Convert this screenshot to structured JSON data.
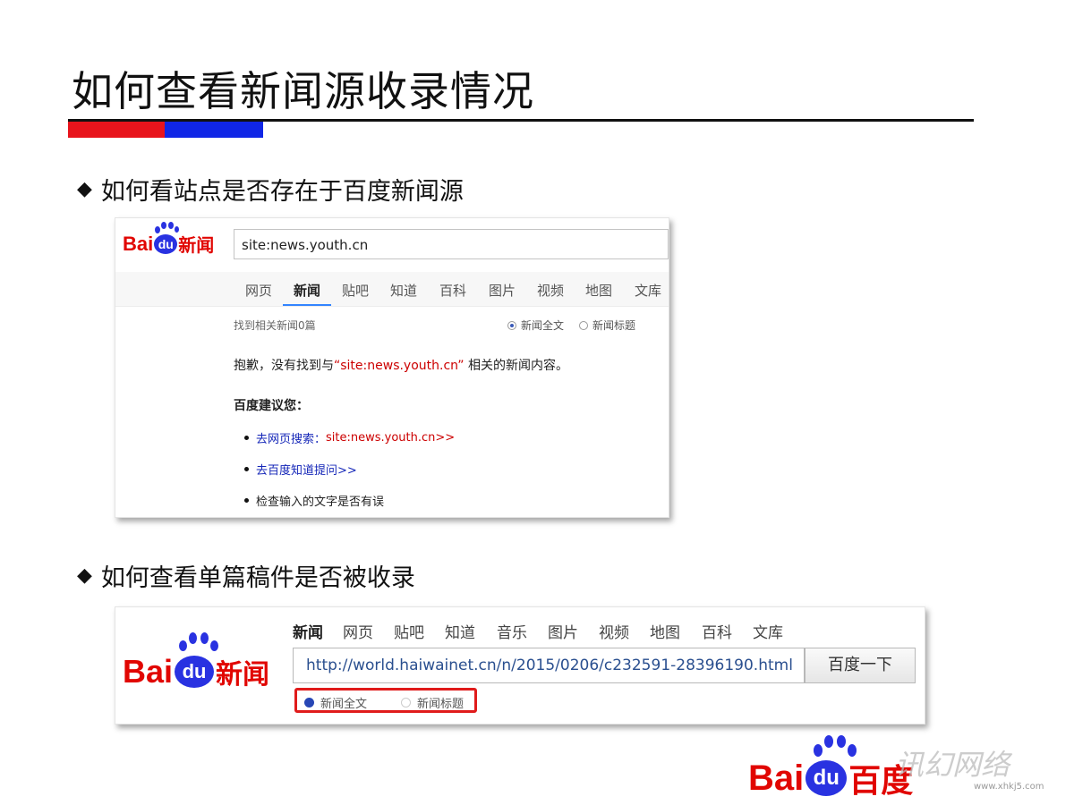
{
  "slide": {
    "title": "如何查看新闻源收录情况",
    "colors": {
      "accent_red": "#e8141c",
      "accent_blue": "#1026e6",
      "rule": "#111111"
    }
  },
  "section1": {
    "bullet": "如何看站点是否存在于百度新闻源",
    "logo": {
      "bai": "Bai",
      "du": "du",
      "product": "新闻"
    },
    "search_value": "site:news.youth.cn",
    "tabs": [
      "网页",
      "新闻",
      "贴吧",
      "知道",
      "百科",
      "图片",
      "视频",
      "地图",
      "文库"
    ],
    "active_tab": "新闻",
    "result_count": "找到相关新闻0篇",
    "radio_options": [
      "新闻全文",
      "新闻标题"
    ],
    "sorry_prefix": "抱歉，没有找到与",
    "sorry_query": "“site:news.youth.cn”",
    "sorry_suffix": " 相关的新闻内容。",
    "suggest_heading": "百度建议您：",
    "suggestions": {
      "web_link_prefix": "去网页搜索：",
      "web_link_query": "site:news.youth.cn>>",
      "zhidao_link": "去百度知道提问>>",
      "check_text": "检查输入的文字是否有误"
    }
  },
  "section2": {
    "bullet": "如何查看单篇稿件是否被收录",
    "logo": {
      "bai": "Bai",
      "du": "du",
      "product": "新闻"
    },
    "tabs": [
      "新闻",
      "网页",
      "贴吧",
      "知道",
      "音乐",
      "图片",
      "视频",
      "地图",
      "百科",
      "文库"
    ],
    "active_tab": "新闻",
    "search_value": "http://world.haiwainet.cn/n/2015/0206/c232591-28396190.html",
    "button_label": "百度一下",
    "radio_options": [
      "新闻全文",
      "新闻标题"
    ],
    "highlight_color": "#e01b1b"
  },
  "footer": {
    "logo": {
      "bai": "Bai",
      "du": "du",
      "product": "百度"
    },
    "watermark": "讯幻网络",
    "watermark_url": "www.xhkj5.com"
  }
}
